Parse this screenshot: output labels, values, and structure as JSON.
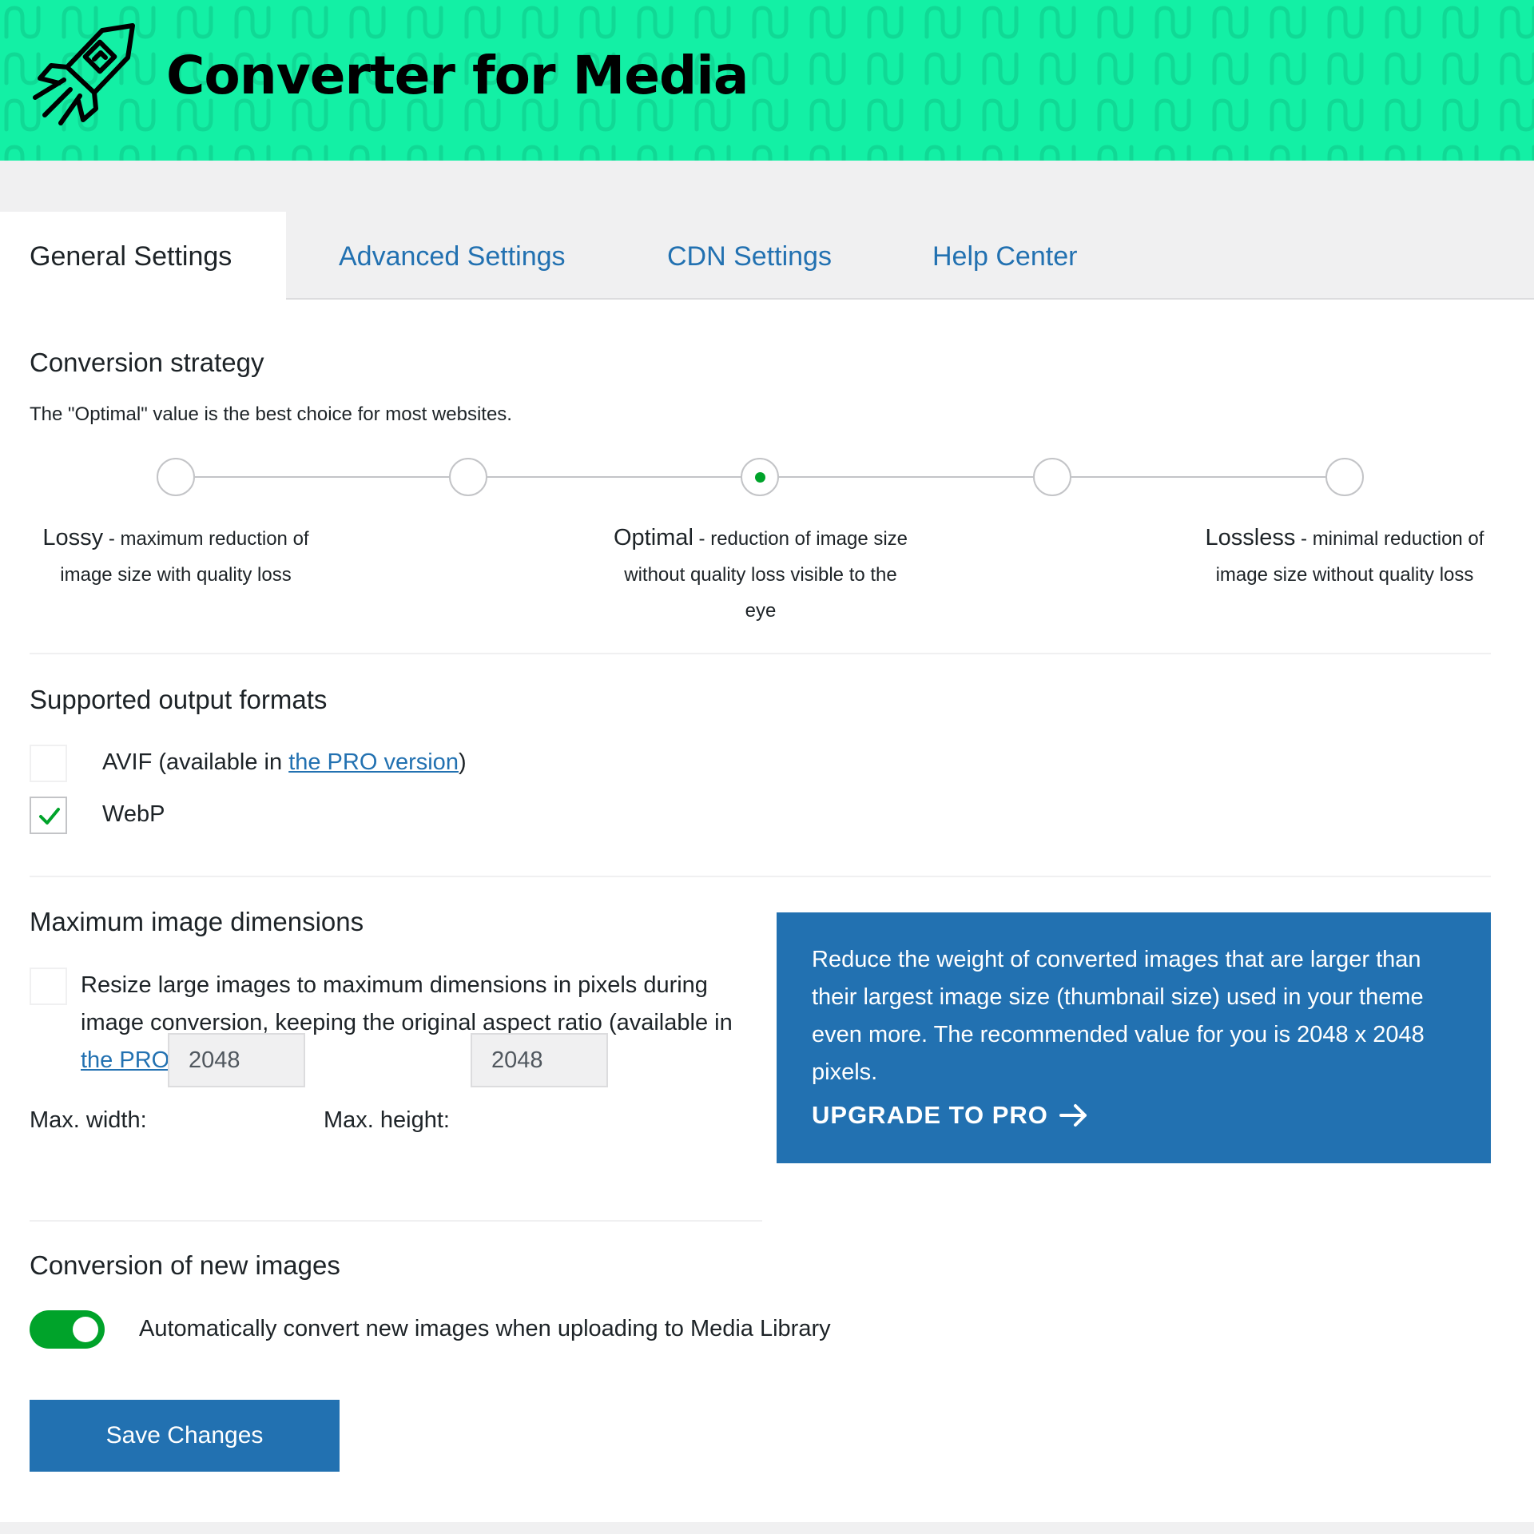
{
  "header": {
    "title": "Converter for Media",
    "background_color": "#13f0a5",
    "logo_icon": "rocket-icon"
  },
  "tabs": [
    {
      "label": "General Settings",
      "active": true
    },
    {
      "label": "Advanced Settings",
      "active": false
    },
    {
      "label": "CDN Settings",
      "active": false
    },
    {
      "label": "Help Center",
      "active": false
    }
  ],
  "conversion_strategy": {
    "title": "Conversion strategy",
    "description": "The \"Optimal\" value is the best choice for most websites.",
    "level_count": 5,
    "selected_level": 3,
    "labels": {
      "lossy": {
        "name": "Lossy",
        "text": " - maximum reduction of image size with quality loss"
      },
      "optimal": {
        "name": "Optimal",
        "text": " - reduction of image size without quality loss visible to the eye"
      },
      "lossless": {
        "name": "Lossless",
        "text": " - minimal reduction of image size without quality loss"
      }
    }
  },
  "output_formats": {
    "title": "Supported output formats",
    "avif": {
      "label_prefix": "AVIF (available in ",
      "link": "the PRO version",
      "label_suffix": ")",
      "checked": false
    },
    "webp": {
      "label": "WebP",
      "checked": true
    }
  },
  "max_dimensions": {
    "title": "Maximum image dimensions",
    "checkbox_text_prefix": "Resize large images to maximum dimensions in pixels during image conversion, keeping the original aspect ratio (available in ",
    "checkbox_link": "the PRO version",
    "checkbox_text_suffix": ")",
    "checked": false,
    "width_label": "Max. width:",
    "width_value": "2048",
    "height_label": "Max. height:",
    "height_value": "2048"
  },
  "promo": {
    "text": "Reduce the weight of converted images that are larger than their largest image size (thumbnail size) used in your theme even more. The recommended value for you is 2048 x 2048 pixels.",
    "cta": "UPGRADE TO PRO",
    "background_color": "#2271b1"
  },
  "new_images": {
    "title": "Conversion of new images",
    "toggle_label": "Automatically convert new images when uploading to Media Library",
    "enabled": true
  },
  "save_button": {
    "label": "Save Changes"
  },
  "colors": {
    "accent": "#2271b1",
    "success": "#00a32a"
  }
}
